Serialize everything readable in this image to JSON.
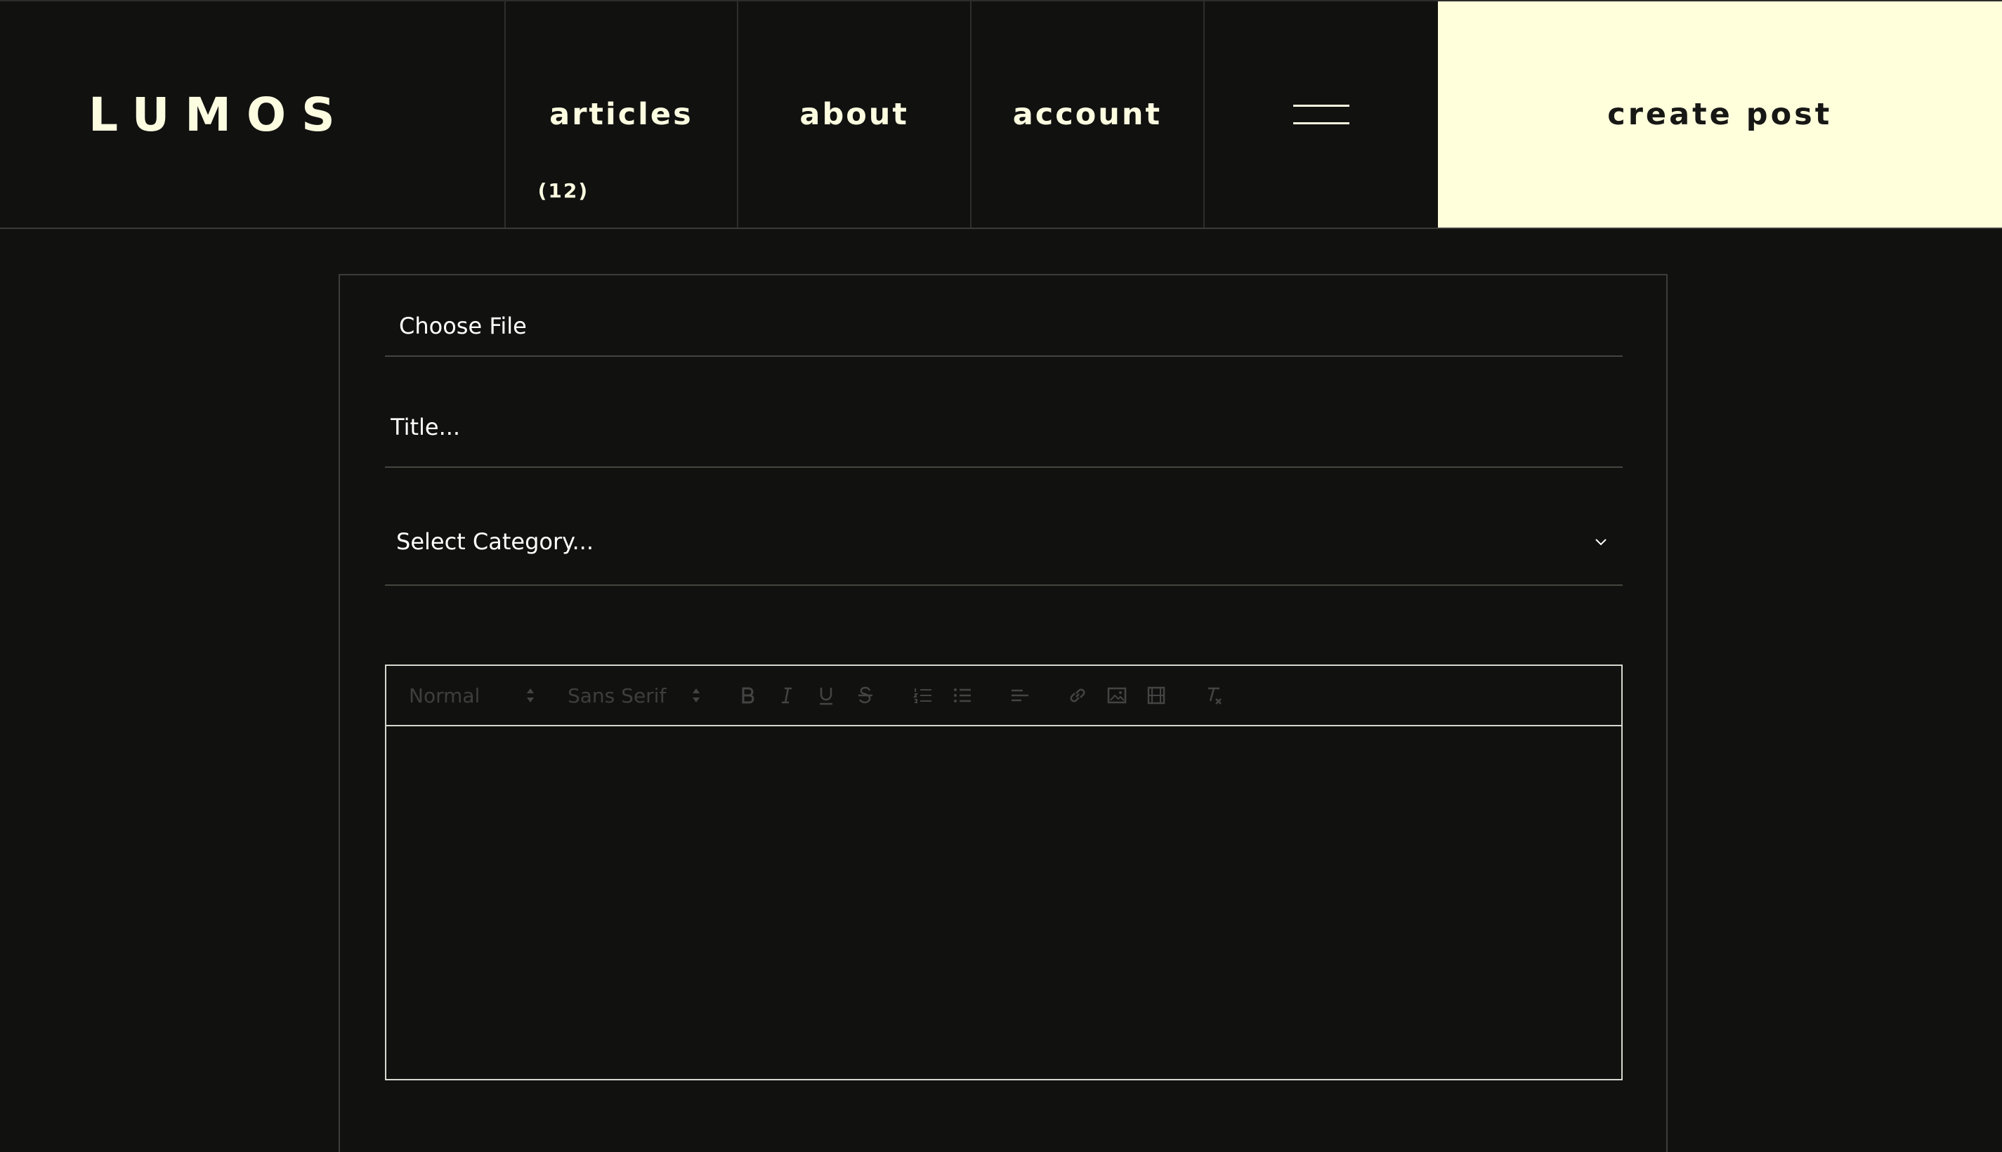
{
  "header": {
    "brand": "LUMOS",
    "nav": [
      {
        "label": "articles",
        "count": "(12)"
      },
      {
        "label": "about"
      },
      {
        "label": "account"
      }
    ],
    "create_label": "create post"
  },
  "form": {
    "file_label": "Choose File",
    "title_placeholder": "Title...",
    "category_placeholder": "Select Category...",
    "toolbar": {
      "size_value": "Normal",
      "font_value": "Sans Serif"
    }
  },
  "colors": {
    "background": "#111110",
    "accent": "#ffffdc",
    "text_light": "#fcfce0"
  },
  "icons": [
    "hamburger-icon",
    "chevron-down-icon",
    "bold-icon",
    "italic-icon",
    "underline-icon",
    "strike-icon",
    "ordered-list-icon",
    "bullet-list-icon",
    "align-icon",
    "link-icon",
    "image-icon",
    "video-icon",
    "clear-format-icon"
  ]
}
